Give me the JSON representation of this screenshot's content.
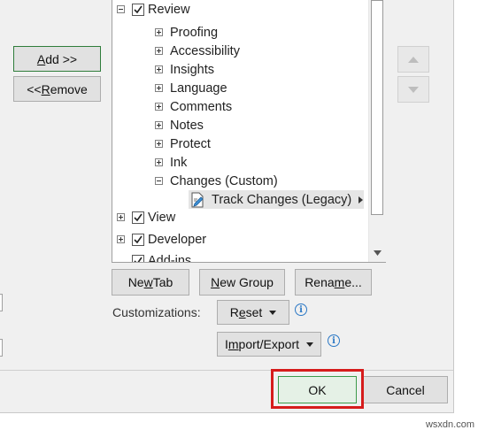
{
  "left_buttons": {
    "add": {
      "pre": "",
      "ul": "A",
      "post": "dd >>"
    },
    "remove": {
      "pre": "<< ",
      "ul": "R",
      "post": "emove"
    }
  },
  "tree": {
    "review": "Review",
    "review_groups": [
      "Proofing",
      "Accessibility",
      "Insights",
      "Language",
      "Comments",
      "Notes",
      "Protect",
      "Ink"
    ],
    "changes_custom": "Changes (Custom)",
    "track_changes": "Track Changes (Legacy)",
    "view": "View",
    "developer": "Developer",
    "addins": "Add-ins"
  },
  "group_buttons": {
    "new_tab": {
      "pre": "Ne",
      "ul": "w",
      "post": " Tab"
    },
    "new_group": {
      "pre": "",
      "ul": "N",
      "post": "ew Group"
    },
    "rename": {
      "pre": "Rena",
      "ul": "m",
      "post": "e..."
    }
  },
  "customizations": {
    "label": "Customizations:",
    "reset": {
      "pre": "R",
      "ul": "e",
      "post": "set"
    },
    "import_export": {
      "pre": "I",
      "ul": "m",
      "post": "port/Export"
    }
  },
  "footer": {
    "ok": "OK",
    "cancel": "Cancel"
  },
  "watermark": "wsxdn.com",
  "colors": {
    "highlight": "#d61c1c",
    "ok_border": "#2f7d3b",
    "info": "#2b78c5"
  }
}
